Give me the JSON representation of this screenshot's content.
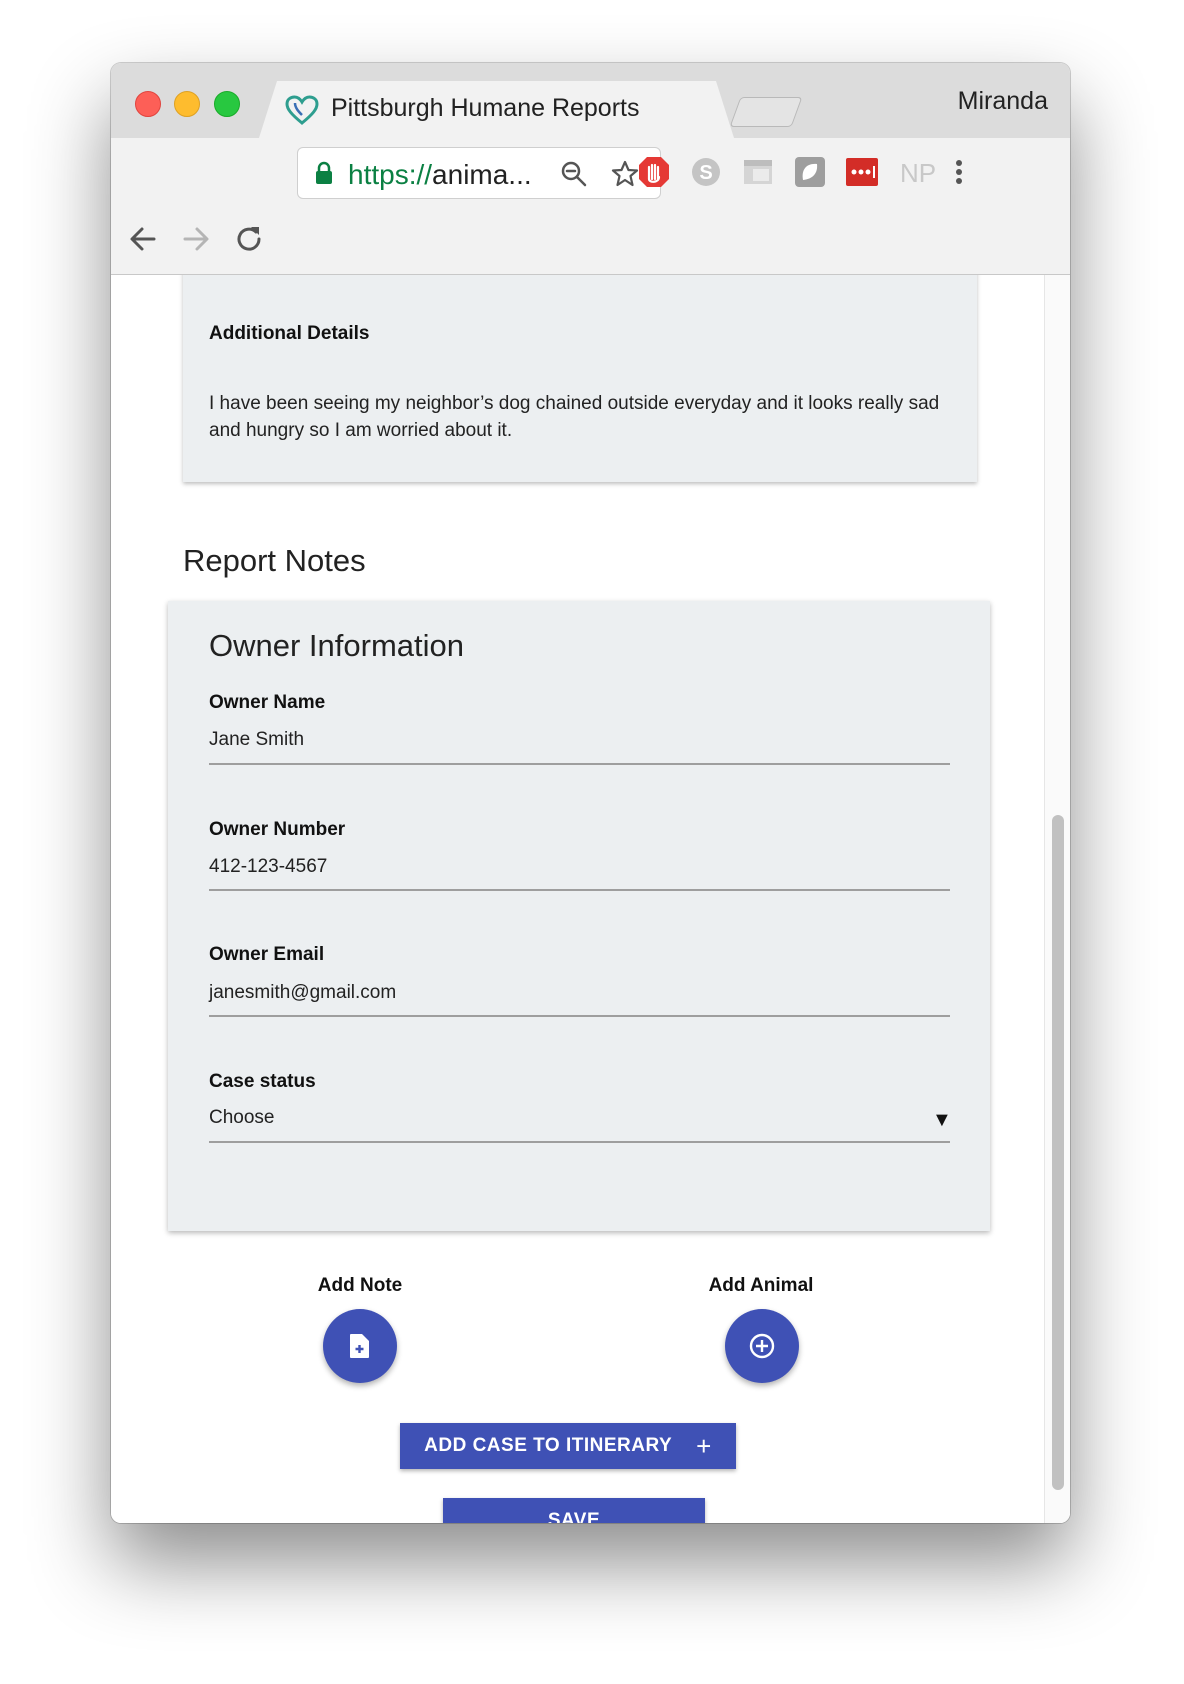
{
  "browser": {
    "tab_title": "Pittsburgh Humane Reports",
    "profile_name": "Miranda",
    "url_scheme": "https://",
    "url_rest": "anima...",
    "extensions": [
      "adblock-icon",
      "skype-icon",
      "reader-icon",
      "ghostery-icon",
      "lastpass-icon",
      "np-icon"
    ],
    "np_label": "NP"
  },
  "report": {
    "details_label": "Additional Details",
    "details_text": "I have been seeing my neighbor’s dog chained outside everyday and it looks really sad and hungry so I am worried about it.",
    "notes_heading": "Report Notes"
  },
  "owner": {
    "card_title": "Owner Information",
    "name_label": "Owner Name",
    "name_value": "Jane Smith",
    "number_label": "Owner Number",
    "number_value": "412-123-4567",
    "email_label": "Owner Email",
    "email_value": "janesmith@gmail.com",
    "status_label": "Case status",
    "status_value": "Choose"
  },
  "actions": {
    "add_note_label": "Add Note",
    "add_animal_label": "Add Animal",
    "itinerary_button": "ADD CASE TO ITINERARY",
    "itinerary_plus": "+",
    "save_button": "SAVE"
  },
  "colors": {
    "primary": "#3f51b5",
    "card_bg": "#eceff1",
    "secure_green": "#0b8043"
  }
}
